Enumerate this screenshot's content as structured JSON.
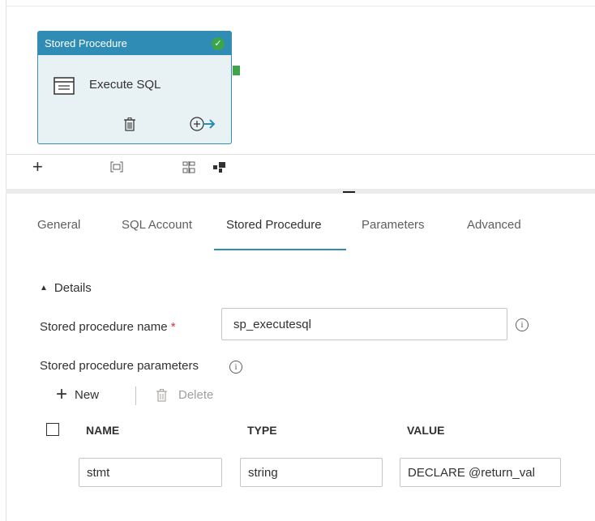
{
  "canvas": {
    "activity": {
      "type_label": "Stored Procedure",
      "name": "Execute SQL",
      "status": "success",
      "icon": "stored-procedure-icon"
    },
    "toolbar": {
      "add_label": "+",
      "icons": [
        "add-icon",
        "fit-to-screen-icon",
        "auto-align-icon",
        "minimap-icon"
      ]
    }
  },
  "tabs": [
    {
      "label": "General"
    },
    {
      "label": "SQL Account"
    },
    {
      "label": "Stored Procedure",
      "active": true
    },
    {
      "label": "Parameters"
    },
    {
      "label": "Advanced"
    }
  ],
  "details": {
    "section_label": "Details",
    "sp_name_label": "Stored procedure name",
    "required_mark": "*",
    "sp_name_value": "sp_executesql",
    "params_label": "Stored procedure parameters",
    "new_label": "New",
    "delete_label": "Delete"
  },
  "params_table": {
    "columns": [
      "NAME",
      "TYPE",
      "VALUE"
    ],
    "rows": [
      {
        "name": "stmt",
        "type": "string",
        "value": "DECLARE @return_val"
      }
    ]
  },
  "colors": {
    "accent": "#2f8cb5",
    "success": "#3ca54a",
    "required": "#d13438"
  }
}
